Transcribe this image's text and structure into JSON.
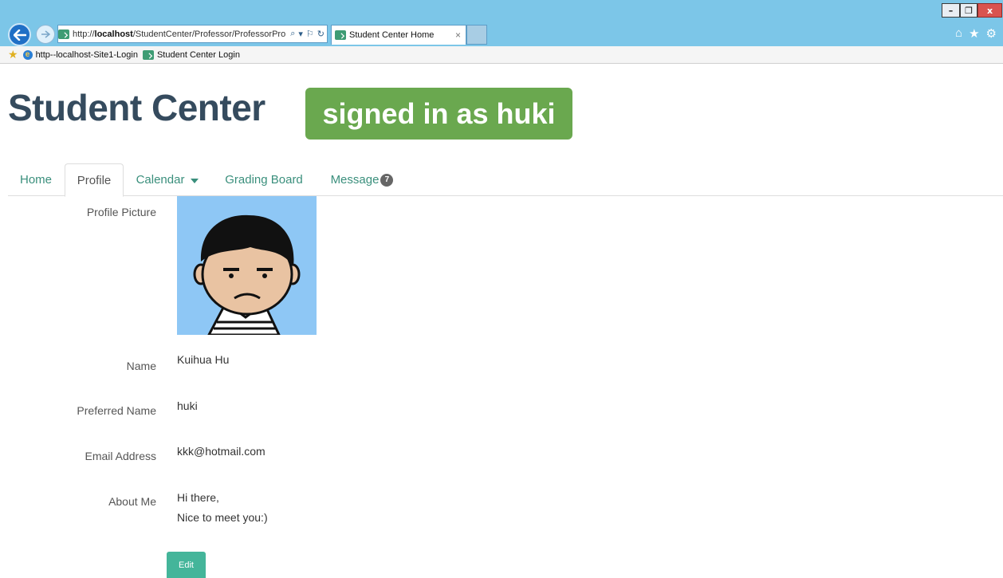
{
  "browser": {
    "url_prefix": "http://",
    "url_host": "localhost",
    "url_path": "/StudentCenter/Professor/ProfessorPro",
    "tab_title": "Student Center Home",
    "tab_close": "×",
    "window_controls": {
      "minimize": "–",
      "maximize": "❐",
      "close": "x"
    },
    "favorites": [
      "http--localhost-Site1-Login",
      "Student Center Login"
    ]
  },
  "header": {
    "title": "Student Center",
    "badge": "signed in as huki"
  },
  "nav": {
    "tabs": [
      {
        "label": "Home"
      },
      {
        "label": "Profile",
        "active": true
      },
      {
        "label": "Calendar",
        "dropdown": true
      },
      {
        "label": "Grading Board"
      },
      {
        "label": "Message",
        "count": "7"
      }
    ]
  },
  "profile": {
    "picture_label": "Profile Picture",
    "name_label": "Name",
    "name": "Kuihua Hu",
    "preferred_label": "Preferred Name",
    "preferred": "huki",
    "email_label": "Email Address",
    "email": "kkk@hotmail.com",
    "about_label": "About Me",
    "about_line1": "Hi there,",
    "about_line2": "Nice to meet you:)",
    "edit_label": "Edit"
  },
  "colors": {
    "accent": "#3a8f7c",
    "badge": "#6aa84f",
    "title": "#354b5e",
    "edit_button": "#44b59a",
    "chrome": "#7cc6e8"
  }
}
